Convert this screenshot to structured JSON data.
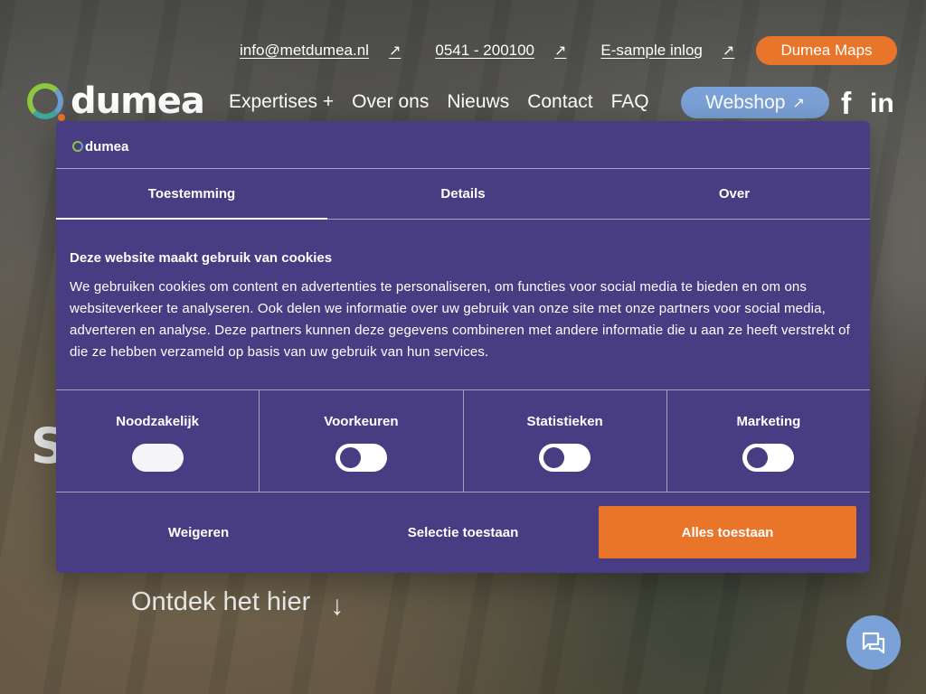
{
  "topbar": {
    "email": "info@metdumea.nl",
    "phone": "0541 - 200100",
    "esample": "E-sample inlog",
    "arrow": "↗",
    "maps_button": "Dumea Maps"
  },
  "brand": {
    "name": "dumea",
    "colors": {
      "orange": "#e9752b",
      "blue": "#7ba2d8",
      "purple": "#483c82",
      "green": "#8dc63f"
    }
  },
  "nav": {
    "items": [
      "Expertises +",
      "Over ons",
      "Nieuws",
      "Contact",
      "FAQ"
    ],
    "webshop": "Webshop",
    "webshop_arrow": "↗",
    "social": {
      "facebook": "f",
      "linkedin": "in"
    }
  },
  "hero": {
    "title_fragment": "S",
    "cta": "Ontdek het hier",
    "cta_arrow": "↓"
  },
  "cookie_dialog": {
    "logo": "dumea",
    "tabs": [
      {
        "label": "Toestemming",
        "active": true
      },
      {
        "label": "Details",
        "active": false
      },
      {
        "label": "Over",
        "active": false
      }
    ],
    "title": "Deze website maakt gebruik van cookies",
    "body": "We gebruiken cookies om content en advertenties te personaliseren, om functies voor social media te bieden en om ons websiteverkeer te analyseren. Ook delen we informatie over uw gebruik van onze site met onze partners voor social media, adverteren en analyse. Deze partners kunnen deze gegevens combineren met andere informatie die u aan ze heeft verstrekt of die ze hebben verzameld op basis van uw gebruik van hun services.",
    "categories": [
      {
        "label": "Noodzakelijk",
        "enabled": true
      },
      {
        "label": "Voorkeuren",
        "enabled": false
      },
      {
        "label": "Statistieken",
        "enabled": false
      },
      {
        "label": "Marketing",
        "enabled": false
      }
    ],
    "actions": {
      "decline": "Weigeren",
      "allow_selection": "Selectie toestaan",
      "allow_all": "Alles toestaan"
    }
  }
}
